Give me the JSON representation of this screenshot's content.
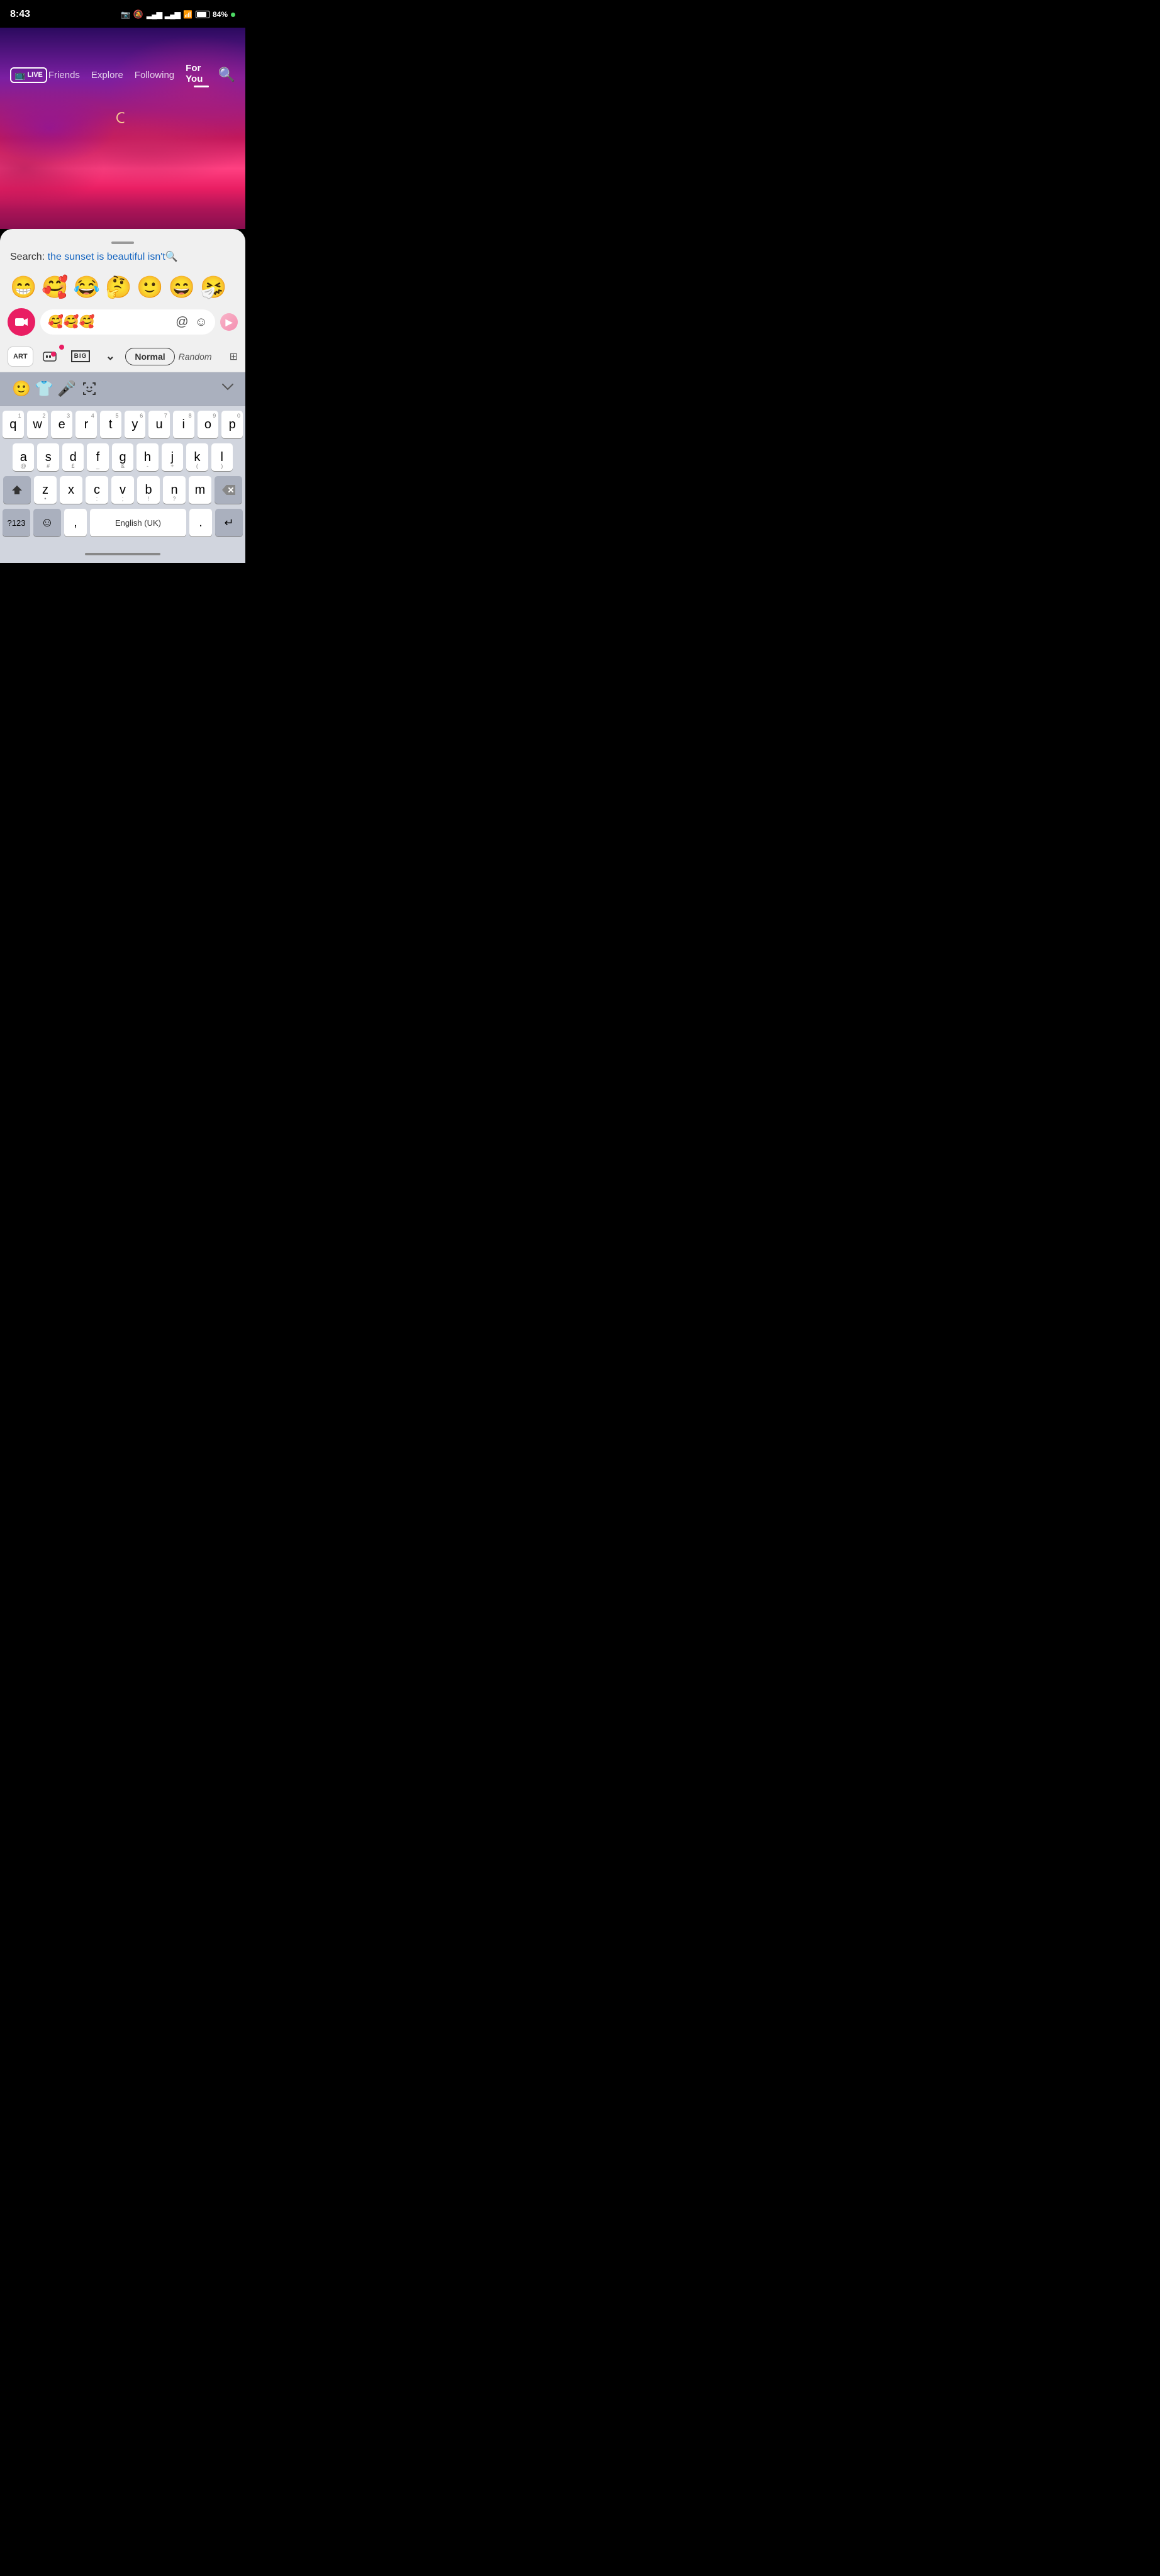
{
  "statusBar": {
    "time": "8:43",
    "battery": "84%",
    "icons": [
      "video",
      "muted",
      "signal1",
      "signal2",
      "wifi"
    ]
  },
  "nav": {
    "tabs": [
      {
        "label": "Friends",
        "active": false
      },
      {
        "label": "Explore",
        "active": false
      },
      {
        "label": "Following",
        "active": false
      },
      {
        "label": "For You",
        "active": true
      }
    ],
    "liveLabel": "LIVE"
  },
  "searchPanel": {
    "prefix": "Search: ",
    "query": "the sunset is beautiful isn't"
  },
  "emojiRow": {
    "emojis": [
      "😁",
      "🥰",
      "😂",
      "🤔",
      "🙂",
      "😄",
      "🤧"
    ]
  },
  "commentInput": {
    "text": "🥰🥰🥰",
    "atSymbol": "@",
    "emojiSymbol": "☺"
  },
  "toolbar": {
    "artLabel": "ART",
    "bigLabel": "BIG",
    "normalLabel": "Normal",
    "randomLabel": "Random",
    "dropdownArrow": "▾"
  },
  "keyboard": {
    "topIcons": [
      "emoji-face",
      "tshirt",
      "microphone",
      "face-id"
    ],
    "row1": [
      {
        "key": "q",
        "num": "1"
      },
      {
        "key": "w",
        "num": "2"
      },
      {
        "key": "e",
        "num": "3"
      },
      {
        "key": "r",
        "num": "4"
      },
      {
        "key": "t",
        "num": "5"
      },
      {
        "key": "y",
        "num": "6"
      },
      {
        "key": "u",
        "num": "7"
      },
      {
        "key": "i",
        "num": "8"
      },
      {
        "key": "o",
        "num": "9"
      },
      {
        "key": "p",
        "num": "0"
      }
    ],
    "row2": [
      {
        "key": "a",
        "sym": "@"
      },
      {
        "key": "s",
        "sym": "#"
      },
      {
        "key": "d",
        "sym": "£"
      },
      {
        "key": "f",
        "sym": "_"
      },
      {
        "key": "g",
        "sym": "&"
      },
      {
        "key": "h",
        "sym": "-"
      },
      {
        "key": "j",
        "sym": "+"
      },
      {
        "key": "k",
        "sym": "("
      },
      {
        "key": "l",
        "sym": ")"
      }
    ],
    "row3": [
      {
        "key": "z",
        "sym": "•"
      },
      {
        "key": "x",
        "sym": ""
      },
      {
        "key": "c",
        "sym": ":"
      },
      {
        "key": "v",
        "sym": ";"
      },
      {
        "key": "b",
        "sym": "!"
      },
      {
        "key": "n",
        "sym": "?"
      },
      {
        "key": "m",
        "sym": ""
      }
    ],
    "bottomRow": {
      "num123": "?123",
      "emoji": "☺",
      "comma": ",",
      "space": "English (UK)",
      "period": ".",
      "microphone": "⬆",
      "return": "↵"
    }
  }
}
